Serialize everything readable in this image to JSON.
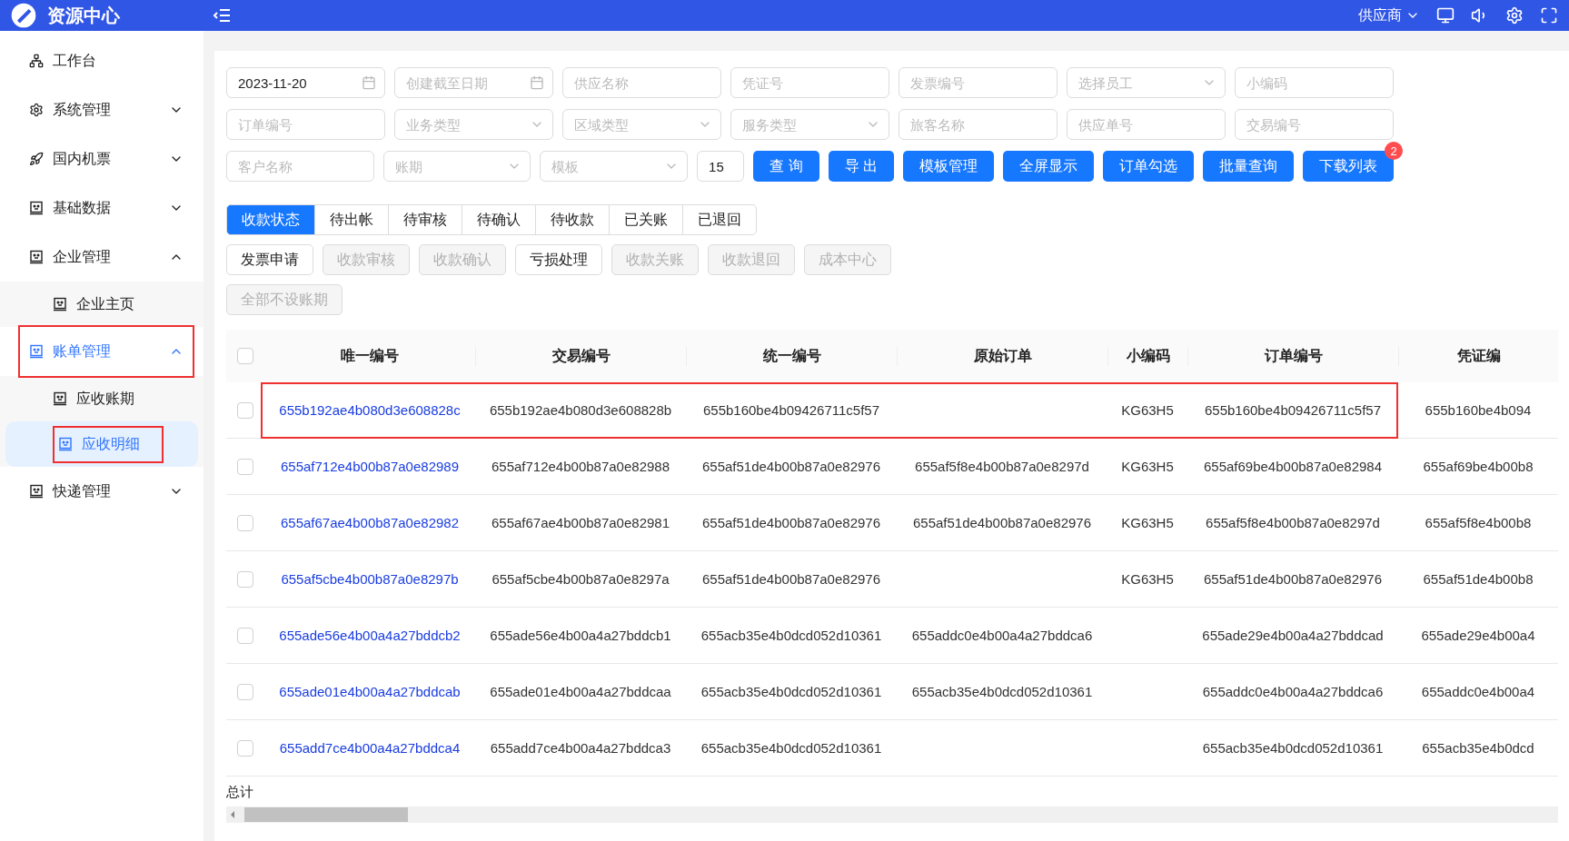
{
  "header": {
    "logo_text": "资源中心",
    "role": "供应商"
  },
  "sidebar": {
    "items": [
      {
        "label": "工作台",
        "kind": "link",
        "selected": false,
        "annotated": false
      },
      {
        "label": "系统管理",
        "kind": "group",
        "expanded": false,
        "selected": false,
        "annotated": false
      },
      {
        "label": "国内机票",
        "kind": "group",
        "expanded": false,
        "selected": false,
        "annotated": false
      },
      {
        "label": "基础数据",
        "kind": "group",
        "expanded": false,
        "selected": false,
        "annotated": false
      },
      {
        "label": "企业管理",
        "kind": "group",
        "expanded": true,
        "selected": false,
        "annotated": false,
        "children": [
          {
            "label": "企业主页",
            "selected": false,
            "annotated": false
          }
        ]
      },
      {
        "label": "账单管理",
        "kind": "group",
        "expanded": true,
        "selected": true,
        "annotated": true,
        "children": [
          {
            "label": "应收账期",
            "selected": false,
            "annotated": false
          },
          {
            "label": "应收明细",
            "selected": true,
            "annotated": true
          }
        ]
      },
      {
        "label": "快递管理",
        "kind": "group",
        "expanded": false,
        "selected": false,
        "annotated": false
      }
    ]
  },
  "filters": [
    {
      "kind": "date",
      "value": "2023-11-20"
    },
    {
      "kind": "date",
      "placeholder": "创建截至日期"
    },
    {
      "kind": "text",
      "placeholder": "供应名称"
    },
    {
      "kind": "text",
      "placeholder": "凭证号"
    },
    {
      "kind": "text",
      "placeholder": "发票编号"
    },
    {
      "kind": "select",
      "placeholder": "选择员工"
    },
    {
      "kind": "text",
      "placeholder": "小编码"
    },
    {
      "kind": "text",
      "placeholder": "订单编号"
    },
    {
      "kind": "select",
      "placeholder": "业务类型"
    },
    {
      "kind": "select",
      "placeholder": "区域类型"
    },
    {
      "kind": "select",
      "placeholder": "服务类型"
    },
    {
      "kind": "text",
      "placeholder": "旅客名称"
    },
    {
      "kind": "text",
      "placeholder": "供应单号"
    },
    {
      "kind": "text",
      "placeholder": "交易编号"
    },
    {
      "kind": "text",
      "placeholder": "客户名称"
    },
    {
      "kind": "select",
      "placeholder": "账期"
    },
    {
      "kind": "select",
      "placeholder": "模板"
    },
    {
      "kind": "number",
      "value": "15"
    }
  ],
  "actions": [
    {
      "label": "查 询"
    },
    {
      "label": "导 出"
    },
    {
      "label": "模板管理"
    },
    {
      "label": "全屏显示"
    },
    {
      "label": "订单勾选"
    },
    {
      "label": "批量查询"
    },
    {
      "label": "下载列表",
      "badge": "2"
    }
  ],
  "status_tabs": [
    {
      "label": "收款状态",
      "selected": true
    },
    {
      "label": "待出帐",
      "selected": false
    },
    {
      "label": "待审核",
      "selected": false
    },
    {
      "label": "待确认",
      "selected": false
    },
    {
      "label": "待收款",
      "selected": false
    },
    {
      "label": "已关账",
      "selected": false
    },
    {
      "label": "已退回",
      "selected": false
    }
  ],
  "operations": [
    {
      "label": "发票申请",
      "disabled": false
    },
    {
      "label": "收款审核",
      "disabled": true
    },
    {
      "label": "收款确认",
      "disabled": true
    },
    {
      "label": "亏损处理",
      "disabled": false
    },
    {
      "label": "收款关账",
      "disabled": true
    },
    {
      "label": "收款退回",
      "disabled": true
    },
    {
      "label": "成本中心",
      "disabled": true
    }
  ],
  "extra_operations": [
    {
      "label": "全部不设账期",
      "disabled": true
    }
  ],
  "table": {
    "all_checked": false,
    "columns": [
      "唯一编号",
      "交易编号",
      "统一编号",
      "原始订单",
      "小编码",
      "订单编号",
      "凭证编"
    ],
    "rows": [
      {
        "checked": false,
        "annotated": true,
        "cells": [
          "655b192ae4b080d3e608828c",
          "655b192ae4b080d3e608828b",
          "655b160be4b09426711c5f57",
          "",
          "KG63H5",
          "655b160be4b09426711c5f57",
          "655b160be4b094"
        ]
      },
      {
        "checked": false,
        "annotated": false,
        "cells": [
          "655af712e4b00b87a0e82989",
          "655af712e4b00b87a0e82988",
          "655af51de4b00b87a0e82976",
          "655af5f8e4b00b87a0e8297d",
          "KG63H5",
          "655af69be4b00b87a0e82984",
          "655af69be4b00b8"
        ]
      },
      {
        "checked": false,
        "annotated": false,
        "cells": [
          "655af67ae4b00b87a0e82982",
          "655af67ae4b00b87a0e82981",
          "655af51de4b00b87a0e82976",
          "655af51de4b00b87a0e82976",
          "KG63H5",
          "655af5f8e4b00b87a0e8297d",
          "655af5f8e4b00b8"
        ]
      },
      {
        "checked": false,
        "annotated": false,
        "cells": [
          "655af5cbe4b00b87a0e8297b",
          "655af5cbe4b00b87a0e8297a",
          "655af51de4b00b87a0e82976",
          "",
          "KG63H5",
          "655af51de4b00b87a0e82976",
          "655af51de4b00b8"
        ]
      },
      {
        "checked": false,
        "annotated": false,
        "cells": [
          "655ade56e4b00a4a27bddcb2",
          "655ade56e4b00a4a27bddcb1",
          "655acb35e4b0dcd052d10361",
          "655addc0e4b00a4a27bddca6",
          "",
          "655ade29e4b00a4a27bddcad",
          "655ade29e4b00a4"
        ]
      },
      {
        "checked": false,
        "annotated": false,
        "cells": [
          "655ade01e4b00a4a27bddcab",
          "655ade01e4b00a4a27bddcaa",
          "655acb35e4b0dcd052d10361",
          "655acb35e4b0dcd052d10361",
          "",
          "655addc0e4b00a4a27bddca6",
          "655addc0e4b00a4"
        ]
      },
      {
        "checked": false,
        "annotated": false,
        "cells": [
          "655add7ce4b00a4a27bddca4",
          "655add7ce4b00a4a27bddca3",
          "655acb35e4b0dcd052d10361",
          "",
          "",
          "655acb35e4b0dcd052d10361",
          "655acb35e4b0dcd"
        ]
      }
    ],
    "footer": "总计"
  }
}
